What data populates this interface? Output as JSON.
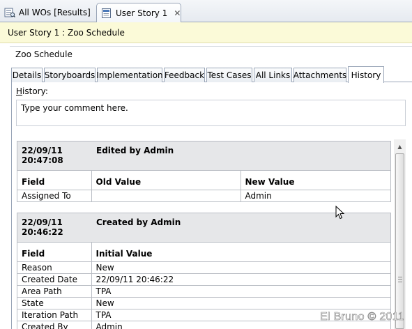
{
  "doc_tabs": [
    {
      "label": "All WOs [Results]",
      "icon": "results-query-icon"
    },
    {
      "label": "User Story 1",
      "icon": "user-story-icon",
      "close": "✕"
    }
  ],
  "work_item": {
    "header": "User Story 1 : Zoo Schedule",
    "title_value": "Zoo Schedule"
  },
  "tabs": [
    "Details",
    "Storyboards",
    "Implementation",
    "Feedback",
    "Test Cases",
    "All Links",
    "Attachments",
    "History"
  ],
  "selected_tab": "History",
  "history": {
    "label_key": "H",
    "label_rest": "istory:",
    "comment_placeholder": "Type your comment here.",
    "entries": [
      {
        "date": "22/09/11",
        "time": "20:47:08",
        "title": "Edited by Admin",
        "columns": [
          "Field",
          "Old Value",
          "New Value"
        ],
        "rows": [
          [
            "Assigned To",
            "",
            "Admin"
          ]
        ]
      },
      {
        "date": "22/09/11",
        "time": "20:46:22",
        "title": "Created by Admin",
        "columns": [
          "Field",
          "Initial Value"
        ],
        "rows": [
          [
            "Reason",
            "New"
          ],
          [
            "Created Date",
            "22/09/11 20:46:22"
          ],
          [
            "Area Path",
            "TPA"
          ],
          [
            "State",
            "New"
          ],
          [
            "Iteration Path",
            "TPA"
          ],
          [
            "Created By",
            "Admin"
          ]
        ]
      }
    ]
  },
  "watermark": "El Bruno © 2011",
  "colors": {
    "title_bar_bg": "#fbfad8",
    "entry_header_bg": "#e6e7e9",
    "tab_border": "#9aa6b8"
  }
}
